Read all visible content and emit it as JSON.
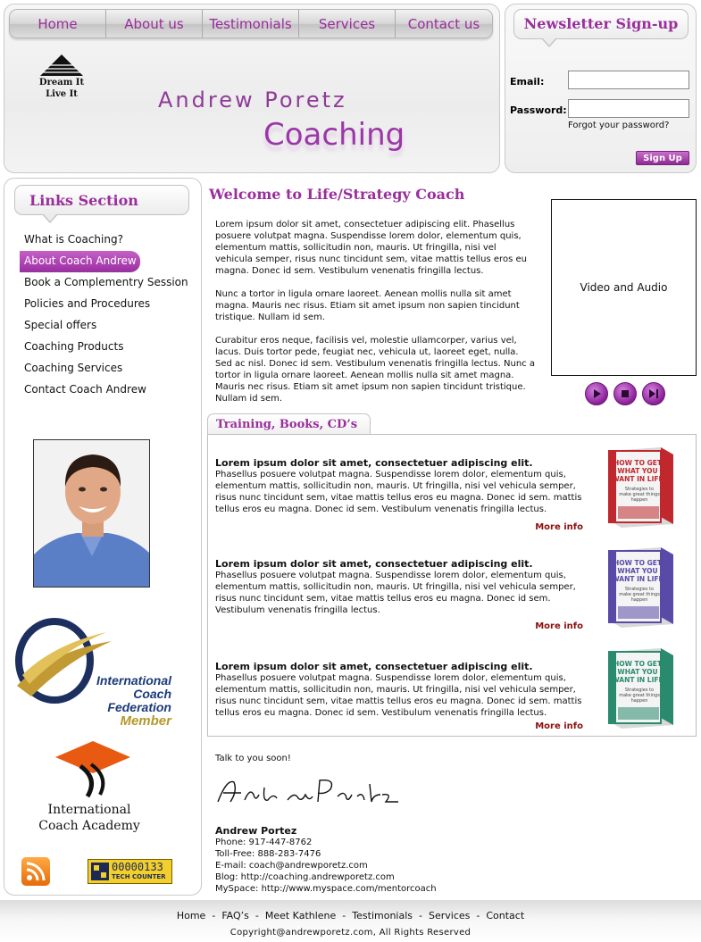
{
  "nav": [
    "Home",
    "About us",
    "Testimonials",
    "Services",
    "Contact us"
  ],
  "logo": {
    "line1": "Dream It",
    "line2": "Live It"
  },
  "brand": {
    "name": "Andrew Poretz",
    "sub": "Coaching"
  },
  "newsletter": {
    "title": "Newsletter Sign-up",
    "email_label": "Email:",
    "password_label": "Password:",
    "forgot": "Forgot your password?",
    "signup": "Sign Up"
  },
  "links": {
    "title": "Links Section",
    "items": [
      "What is Coaching?",
      "About Coach Andrew",
      "Book a Complementry Session",
      "Policies and Procedures",
      "Special offers",
      "Coaching Products",
      "Coaching Services",
      "Contact Coach Andrew"
    ],
    "active_index": 1
  },
  "badges": {
    "icf_line1": "International",
    "icf_line2": "Coach Federation",
    "icf_line3": "Member",
    "ica_line1": "International",
    "ica_line2": "Coach Academy",
    "counter_value": "00000133",
    "counter_label": "TECH COUNTER"
  },
  "main": {
    "title": "Welcome to Life/Strategy Coach",
    "paragraphs": [
      "Lorem ipsum dolor sit amet, consectetuer adipiscing elit. Phasellus posuere volutpat magna. Suspendisse lorem dolor, elementum quis, elementum mattis, sollicitudin non, mauris. Ut fringilla, nisi vel vehicula semper, risus nunc tincidunt sem, vitae mattis tellus eros eu magna. Donec id sem. Vestibulum venenatis fringilla lectus.",
      "Nunc a tortor in ligula ornare laoreet. Aenean mollis nulla sit amet magna. Mauris nec risus. Etiam sit amet ipsum non sapien tincidunt tristique. Nullam id sem.",
      "Curabitur eros neque, facilisis vel, molestie ullamcorper, varius vel, lacus. Duis tortor pede, feugiat nec, vehicula ut, laoreet eget, nulla. Sed ac nisl. Donec id sem. Vestibulum venenatis fringilla lectus. Nunc a tortor in ligula ornare laoreet. Aenean mollis nulla sit amet magna. Mauris nec risus. Etiam sit amet ipsum non sapien tincidunt tristique. Nullam id sem."
    ],
    "video_label": "Video and Audio"
  },
  "products": {
    "tab": "Training, Books, CD’s",
    "items": [
      {
        "title": "Lorem ipsum dolor sit amet, consectetuer adipiscing elit.",
        "body": "Phasellus posuere volutpat magna. Suspendisse lorem dolor, elementum quis, elementum mattis, sollicitudin non, mauris. Ut fringilla, nisi vel vehicula semper, risus nunc tincidunt sem, vitae mattis tellus eros eu magna. Donec id sem. mattis tellus eros eu magna. Donec id sem. Vestibulum venenatis fringilla lectus.",
        "more": "More info",
        "color": "#c0282d"
      },
      {
        "title": "Lorem ipsum dolor sit amet, consectetuer adipiscing elit.",
        "body": "Phasellus posuere volutpat magna. Suspendisse lorem dolor, elementum quis, elementum mattis, sollicitudin non, mauris. Ut fringilla, nisi vel vehicula semper, risus nunc tincidunt sem, vitae mattis tellus eros eu magna. Donec id sem. Vestibulum venenatis fringilla lectus.",
        "more": "More info",
        "color": "#5a4aa8"
      },
      {
        "title": "Lorem ipsum dolor sit amet, consectetuer adipiscing elit.",
        "body": "Phasellus posuere volutpat magna. Suspendisse lorem dolor, elementum quis, elementum mattis, sollicitudin non, mauris. Ut fringilla, nisi vel vehicula semper, risus nunc tincidunt sem, vitae mattis tellus eros eu magna. Donec id sem. mattis tellus eros eu magna. Donec id sem. Vestibulum venenatis fringilla lectus.",
        "more": "More info",
        "color": "#2a8a6e"
      }
    ],
    "book": {
      "line1": "HOW TO GET",
      "line2": "WHAT YOU",
      "line3": "WANT IN LIFE",
      "line4": "Strategies to make great things happen"
    }
  },
  "closing": {
    "talk": "Talk to you soon!",
    "signature": "Andrew Poretz",
    "name": "Andrew Portez",
    "lines": [
      "Phone: 917-447-8762",
      "Toll-Free:  888-283-7476",
      "E-mail:  coach@andrewporetz.com",
      "Blog:  http://coaching.andrewporetz.com",
      "MySpace:  http://www.myspace.com/mentorcoach"
    ]
  },
  "footer": {
    "nav": [
      "Home",
      "FAQ’s",
      "Meet Kathlene",
      "Testimonials",
      "Services",
      "Contact"
    ],
    "copyright": "Copyright@andrewporetz.com, All Rights Reserved"
  },
  "colors": {
    "accent": "#9a2f9c",
    "more_link": "#8a1010"
  }
}
